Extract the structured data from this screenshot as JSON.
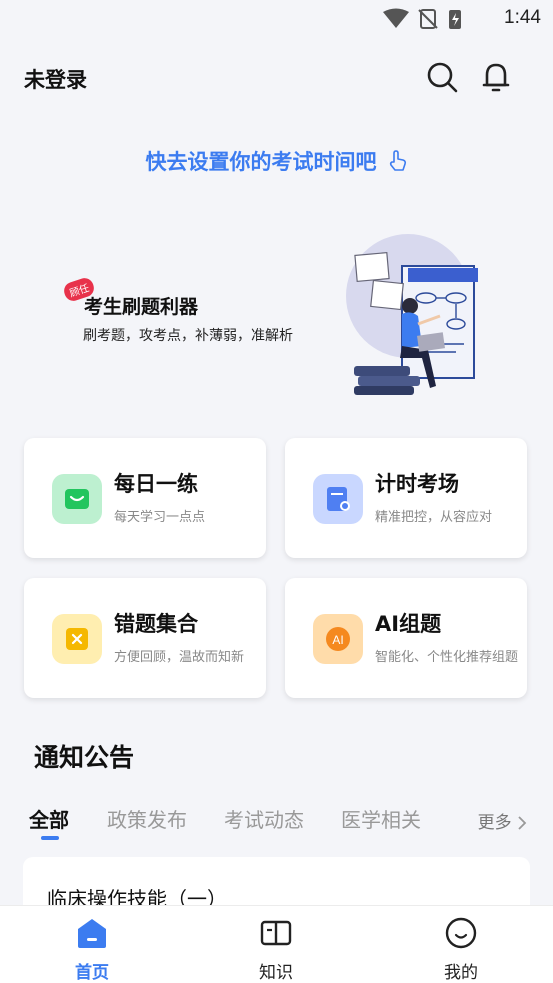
{
  "status_bar": {
    "time": "1:44"
  },
  "header": {
    "title": "未登录"
  },
  "exam_prompt": "快去设置你的考试时间吧",
  "banner": {
    "badge": "顾任",
    "title": "考生刷题利器",
    "subtitle": "刷考题，攻考点，补薄弱，准解析"
  },
  "features": [
    {
      "title": "每日一练",
      "subtitle": "每天学习一点点",
      "color": "#22c55e",
      "bg": "#bdf0d0"
    },
    {
      "title": "计时考场",
      "subtitle": "精准把控，从容应对",
      "color": "#4f7ff2",
      "bg": "#c9d7ff"
    },
    {
      "title": "错题集合",
      "subtitle": "方便回顾，温故而知新",
      "color": "#f5b800",
      "bg": "#ffeeb0"
    },
    {
      "title": "AI组题",
      "subtitle": "智能化、个性化推荐组题",
      "color": "#f5891f",
      "bg": "#ffdcaa",
      "icon_text": "AI"
    }
  ],
  "notice": {
    "title": "通知公告",
    "tabs": [
      "全部",
      "政策发布",
      "考试动态",
      "医学相关"
    ],
    "active_tab": 0,
    "more": "更多",
    "items": [
      "临床操作技能（一）"
    ]
  },
  "bottom_nav": [
    {
      "label": "首页",
      "icon": "home-icon",
      "active": true
    },
    {
      "label": "知识",
      "icon": "book-icon",
      "active": false
    },
    {
      "label": "我的",
      "icon": "smile-icon",
      "active": false
    }
  ],
  "colors": {
    "accent": "#3c7cf0",
    "background": "#f4f5f9"
  }
}
